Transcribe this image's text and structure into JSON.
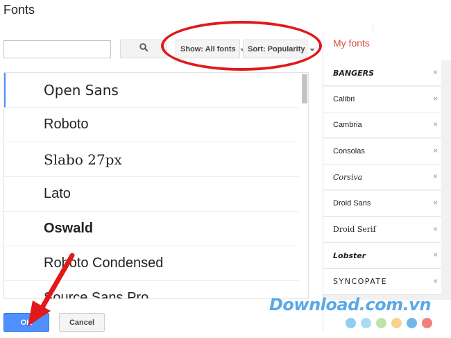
{
  "dialog": {
    "title": "Fonts"
  },
  "search": {
    "placeholder": "",
    "button_icon": "search-icon"
  },
  "filters": {
    "show_label": "Show: All fonts",
    "sort_label": "Sort: Popularity"
  },
  "font_list": {
    "items": [
      {
        "label": "Open Sans",
        "family": "\"DejaVu Sans\", sans-serif",
        "weight": "normal",
        "selected": true
      },
      {
        "label": "Roboto",
        "family": "\"Liberation Sans\", sans-serif",
        "weight": "normal",
        "selected": false
      },
      {
        "label": "Slabo 27px",
        "family": "\"DejaVu Serif\", serif",
        "weight": "normal",
        "selected": false
      },
      {
        "label": "Lato",
        "family": "\"Liberation Sans\", sans-serif",
        "weight": "normal",
        "selected": false
      },
      {
        "label": "Oswald",
        "family": "\"Liberation Sans\", sans-serif",
        "weight": "bold",
        "selected": false
      },
      {
        "label": "Roboto Condensed",
        "family": "\"Liberation Sans\", sans-serif",
        "weight": "normal",
        "selected": false
      },
      {
        "label": "Source Sans Pro",
        "family": "\"Liberation Sans\", sans-serif",
        "weight": "normal",
        "selected": false
      }
    ]
  },
  "my_fonts": {
    "title": "My fonts",
    "items": [
      {
        "label": "BANGERS",
        "style": "italic-bold"
      },
      {
        "label": "Calibri",
        "style": "normal"
      },
      {
        "label": "Cambria",
        "style": "normal"
      },
      {
        "label": "Consolas",
        "style": "normal"
      },
      {
        "label": "Corsiva",
        "style": "italic"
      },
      {
        "label": "Droid Sans",
        "style": "normal"
      },
      {
        "label": "Droid Serif",
        "style": "serif"
      },
      {
        "label": "Lobster",
        "style": "italic-bold"
      },
      {
        "label": "SYNCOPATE",
        "style": "wide"
      }
    ],
    "remove_icon": "×"
  },
  "actions": {
    "ok_label": "OK",
    "cancel_label": "Cancel"
  },
  "watermark": {
    "text": "Download.com.vn"
  },
  "colors": {
    "accent": "#4d90fe",
    "my_fonts_title": "#dd4b39",
    "annotation": "#e01a1a",
    "watermark_dots": [
      "#8fd0f2",
      "#a9dbf5",
      "#bfe3a6",
      "#f7d28a",
      "#6fb7e8",
      "#f08080"
    ]
  }
}
